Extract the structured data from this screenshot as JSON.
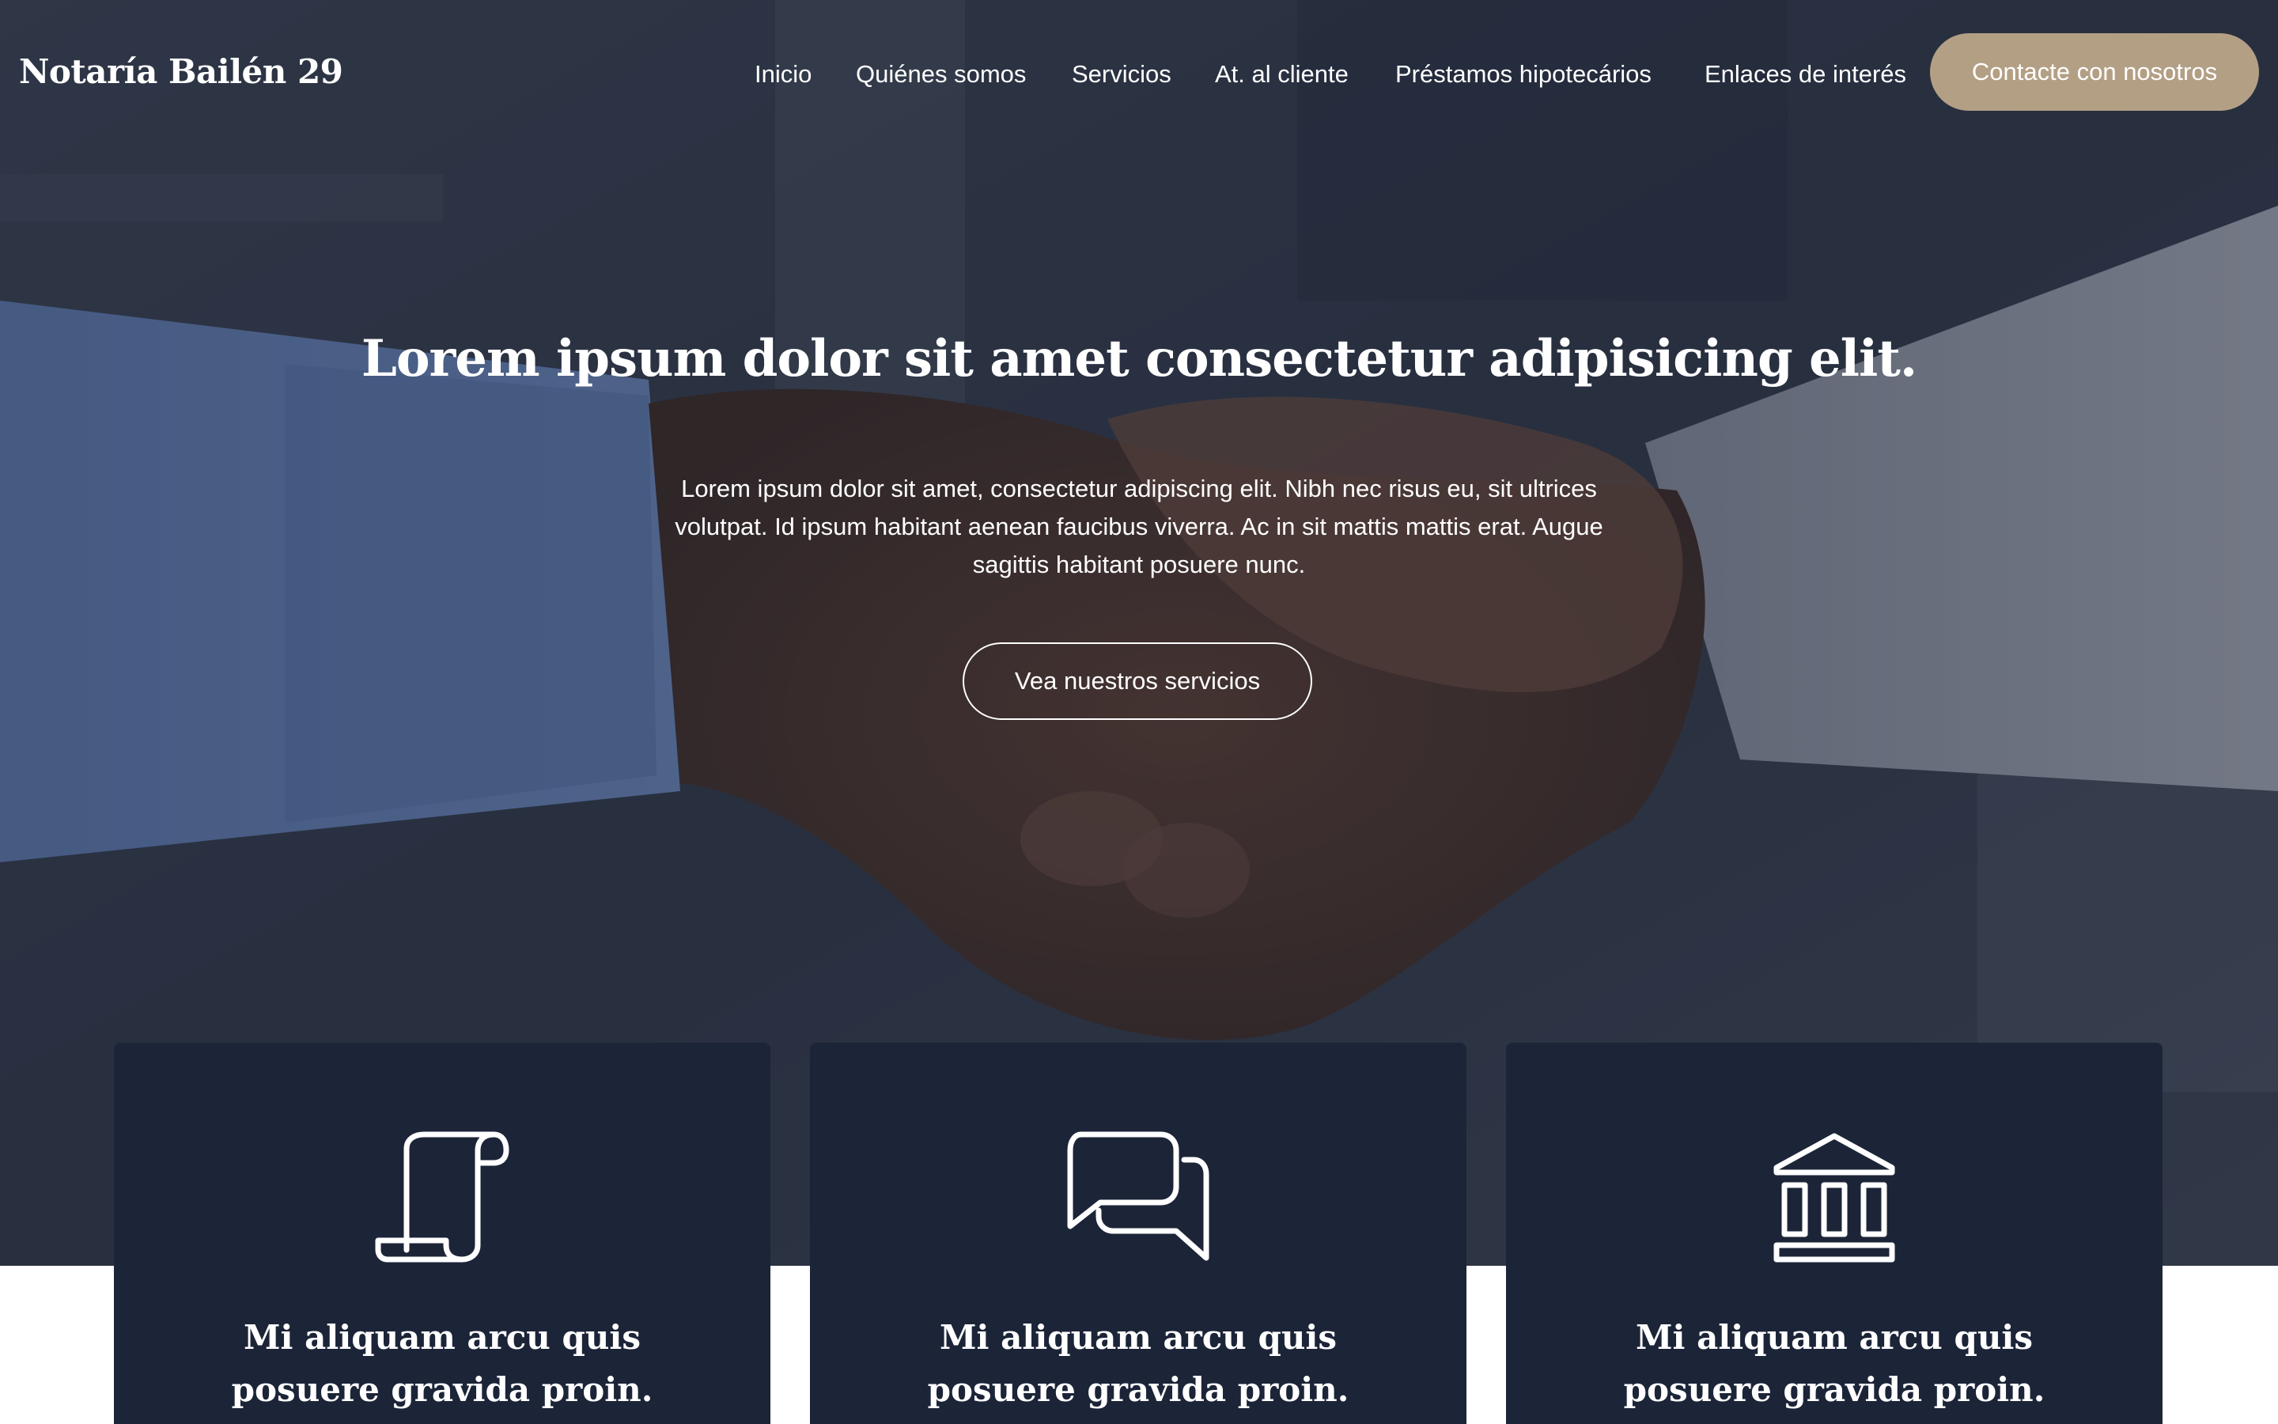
{
  "brand": {
    "name": "Notaría Bailén 29"
  },
  "nav": {
    "items": [
      "Inicio",
      "Quiénes somos",
      "Servicios",
      "At. al cliente",
      "Préstamos hipotecários",
      "Enlaces de interés"
    ],
    "cta_label": "Contacte con nosotros"
  },
  "hero": {
    "title": "Lorem ipsum dolor sit amet consectetur adipisicing elit.",
    "text": "Lorem ipsum dolor sit amet, consectetur adipiscing elit. Nibh nec risus eu, sit ultrices volutpat. Id ipsum habitant aenean faucibus viverra. Ac in sit mattis mattis erat. Augue sagittis habitant posuere nunc.",
    "button_label": "Vea nuestros servicios"
  },
  "cards": [
    {
      "icon": "scroll-icon",
      "title": "Mi aliquam arcu quis posuere gravida proin."
    },
    {
      "icon": "chat-bubbles-icon",
      "title": "Mi aliquam arcu quis posuere gravida proin."
    },
    {
      "icon": "bank-building-icon",
      "title": "Mi aliquam arcu quis posuere gravida proin."
    }
  ],
  "colors": {
    "accent": "#b39f84",
    "card_background": "#1c2438",
    "text_light": "#ffffff"
  }
}
